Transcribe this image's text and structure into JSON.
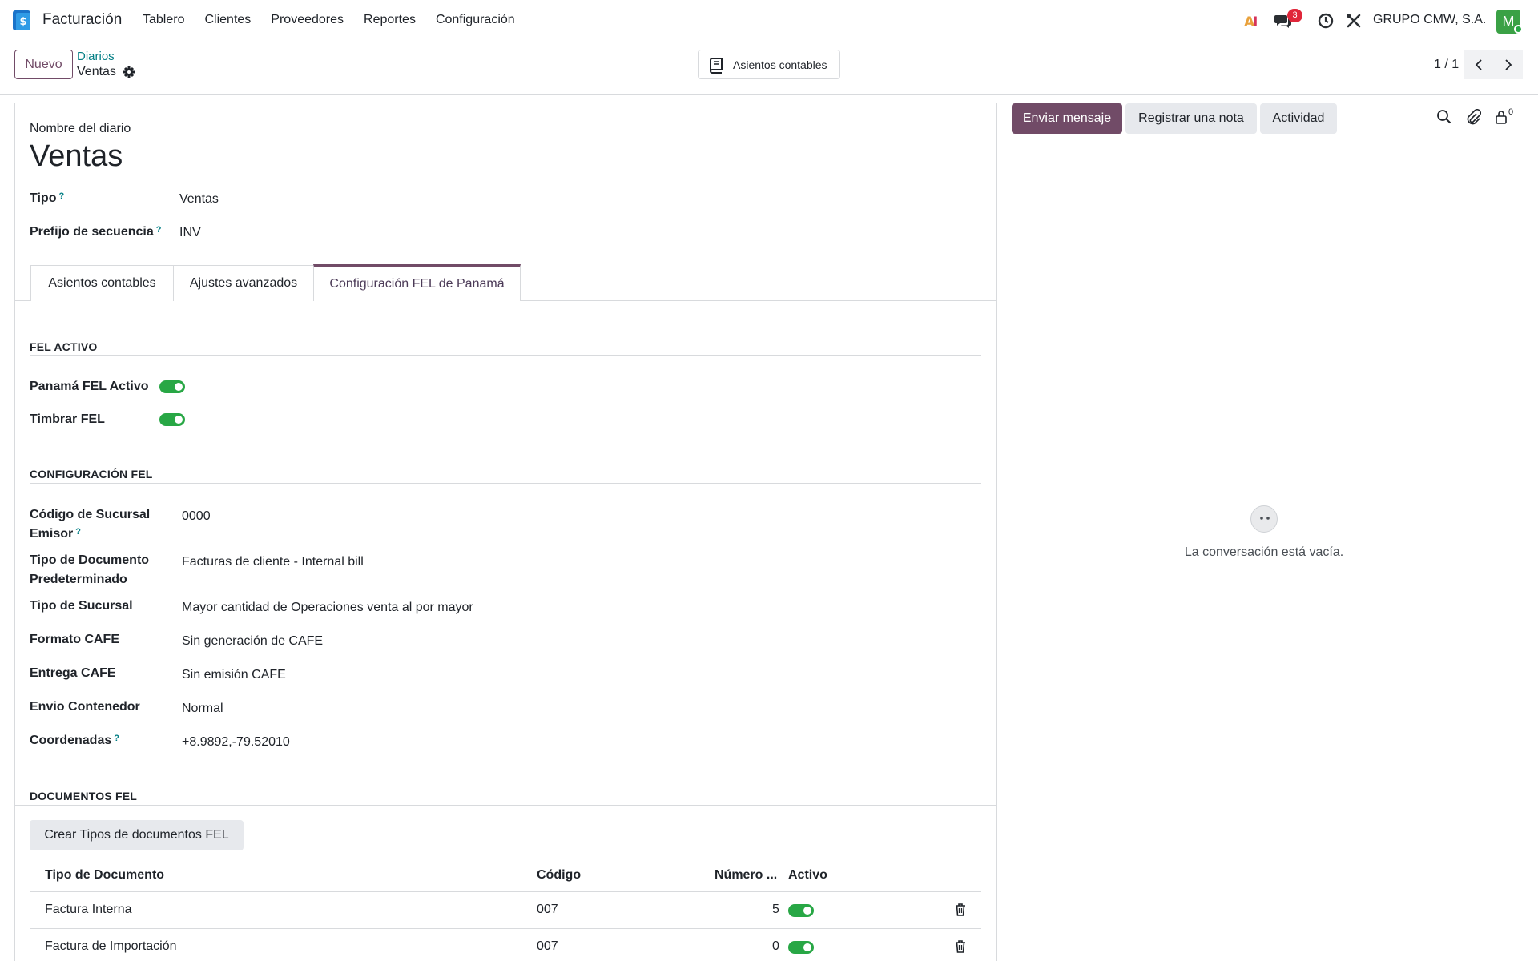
{
  "navbar": {
    "app_name": "Facturación",
    "menu": [
      "Tablero",
      "Clientes",
      "Proveedores",
      "Reportes",
      "Configuración"
    ],
    "messages_badge": "3",
    "company": "GRUPO CMW, S.A.",
    "avatar_initial": "M"
  },
  "control_panel": {
    "new_button": "Nuevo",
    "breadcrumb_parent": "Diarios",
    "breadcrumb_current": "Ventas",
    "smart_button": "Asientos contables",
    "pager": "1 / 1"
  },
  "form": {
    "name_label": "Nombre del diario",
    "name_value": "Ventas",
    "type_label": "Tipo",
    "type_value": "Ventas",
    "prefix_label": "Prefijo de secuencia",
    "prefix_value": "INV",
    "help_mark": "?"
  },
  "tabs": [
    "Asientos contables",
    "Ajustes avanzados",
    "Configuración FEL de Panamá"
  ],
  "fel_activo": {
    "title": "FEL ACTIVO",
    "panama_label": "Panamá FEL Activo",
    "timbrar_label": "Timbrar FEL"
  },
  "config_fel": {
    "title": "CONFIGURACIÓN FEL",
    "codigo_label_1": "Código de Sucursal",
    "codigo_label_2": "Emisor",
    "codigo_value": "0000",
    "tipo_doc_label_1": "Tipo de Documento",
    "tipo_doc_label_2": "Predeterminado",
    "tipo_doc_value": "Facturas de cliente - Internal bill",
    "tipo_sucursal_label": "Tipo de Sucursal",
    "tipo_sucursal_value": "Mayor cantidad de Operaciones venta al por mayor",
    "formato_label": "Formato CAFE",
    "formato_value": "Sin generación de CAFE",
    "entrega_label": "Entrega CAFE",
    "entrega_value": "Sin emisión CAFE",
    "envio_label": "Envio Contenedor",
    "envio_value": "Normal",
    "coord_label": "Coordenadas",
    "coord_value": "+8.9892,-79.52010"
  },
  "documentos_fel": {
    "title": "DOCUMENTOS FEL",
    "create_button": "Crear Tipos de documentos FEL",
    "columns": [
      "Tipo de Documento",
      "Código",
      "Número ...",
      "Activo"
    ],
    "rows": [
      {
        "tipo": "Factura Interna",
        "codigo": "007",
        "numero": "5",
        "activo": true
      },
      {
        "tipo": "Factura de Importación",
        "codigo": "007",
        "numero": "0",
        "activo": true
      }
    ]
  },
  "chatter": {
    "send_message": "Enviar mensaje",
    "log_note": "Registrar una nota",
    "activity": "Actividad",
    "followers_count": "0",
    "empty_text": "La conversación está vacía."
  },
  "colors": {
    "brand": "#714b67",
    "link": "#017e84",
    "toggle_on": "#28a745"
  }
}
